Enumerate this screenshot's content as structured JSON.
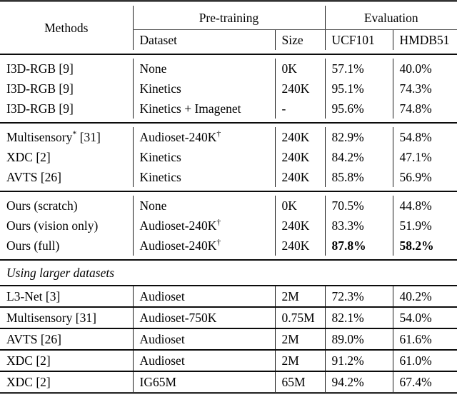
{
  "table": {
    "header": {
      "methods": "Methods",
      "group_pretraining": "Pre-training",
      "group_evaluation": "Evaluation",
      "col_dataset": "Dataset",
      "col_size": "Size",
      "col_ucf101": "UCF101",
      "col_hmdb51": "HMDB51"
    },
    "section_label": "Using larger datasets",
    "blocks": [
      {
        "rows": [
          {
            "method": "I3D-RGB [9]",
            "method_sup": "",
            "dataset": "None",
            "dataset_sup": "",
            "size": "0K",
            "ucf101": "57.1%",
            "hmdb51": "40.0%",
            "bold": false
          },
          {
            "method": "I3D-RGB [9]",
            "method_sup": "",
            "dataset": "Kinetics",
            "dataset_sup": "",
            "size": "240K",
            "ucf101": "95.1%",
            "hmdb51": "74.3%",
            "bold": false
          },
          {
            "method": "I3D-RGB [9]",
            "method_sup": "",
            "dataset": "Kinetics + Imagenet",
            "dataset_sup": "",
            "size": "-",
            "ucf101": "95.6%",
            "hmdb51": "74.8%",
            "bold": false
          }
        ]
      },
      {
        "rows": [
          {
            "method": "Multisensory",
            "method_sup": "*",
            "method_tail": " [31]",
            "dataset": "Audioset-240K",
            "dataset_sup": "†",
            "size": "240K",
            "ucf101": "82.9%",
            "hmdb51": "54.8%",
            "bold": false
          },
          {
            "method": "XDC [2]",
            "method_sup": "",
            "dataset": "Kinetics",
            "dataset_sup": "",
            "size": "240K",
            "ucf101": "84.2%",
            "hmdb51": "47.1%",
            "bold": false
          },
          {
            "method": "AVTS [26]",
            "method_sup": "",
            "dataset": "Kinetics",
            "dataset_sup": "",
            "size": "240K",
            "ucf101": "85.8%",
            "hmdb51": "56.9%",
            "bold": false
          }
        ]
      },
      {
        "rows": [
          {
            "method": "Ours (scratch)",
            "method_sup": "",
            "dataset": "None",
            "dataset_sup": "",
            "size": "0K",
            "ucf101": "70.5%",
            "hmdb51": "44.8%",
            "bold": false
          },
          {
            "method": "Ours (vision only)",
            "method_sup": "",
            "dataset": "Audioset-240K",
            "dataset_sup": "†",
            "size": "240K",
            "ucf101": "83.3%",
            "hmdb51": "51.9%",
            "bold": false
          },
          {
            "method": "Ours (full)",
            "method_sup": "",
            "dataset": "Audioset-240K",
            "dataset_sup": "†",
            "size": "240K",
            "ucf101": "87.8%",
            "hmdb51": "58.2%",
            "bold": true
          }
        ]
      }
    ],
    "large_rows": [
      {
        "method": "L3-Net [3]",
        "dataset": "Audioset",
        "size": "2M",
        "ucf101": "72.3%",
        "hmdb51": "40.2%"
      },
      {
        "method": "Multisensory [31]",
        "dataset": "Audioset-750K",
        "size": "0.75M",
        "ucf101": "82.1%",
        "hmdb51": "54.0%"
      },
      {
        "method": "AVTS [26]",
        "dataset": "Audioset",
        "size": "2M",
        "ucf101": "89.0%",
        "hmdb51": "61.6%"
      },
      {
        "method": "XDC [2]",
        "dataset": "Audioset",
        "size": "2M",
        "ucf101": "91.2%",
        "hmdb51": "61.0%"
      },
      {
        "method": "XDC [2]",
        "dataset": "IG65M",
        "size": "65M",
        "ucf101": "94.2%",
        "hmdb51": "67.4%"
      }
    ]
  }
}
